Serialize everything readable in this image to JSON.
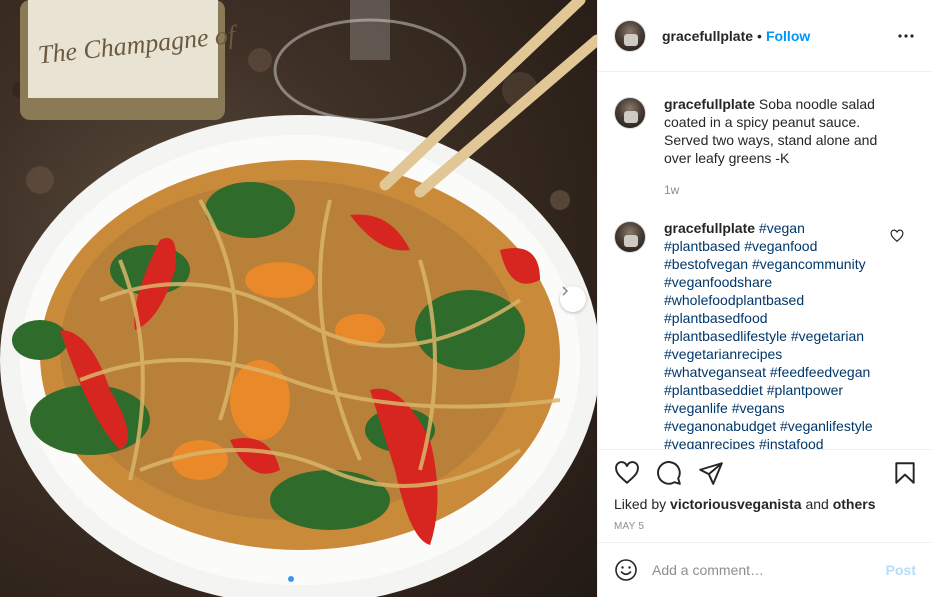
{
  "post": {
    "username": "gracefullplate",
    "separator": "•",
    "follow_label": "Follow",
    "photo_alt": "The Champagne of",
    "carousel_count": 2,
    "carousel_active": 1
  },
  "caption": {
    "username": "gracefullplate",
    "text": "Soba noodle salad coated in a spicy peanut sauce. Served two ways, stand alone and over leafy greens -K",
    "time": "1w"
  },
  "hashtag_comment": {
    "username": "gracefullplate",
    "tags": [
      "#vegan",
      "#plantbased",
      "#veganfood",
      "#bestofvegan",
      "#vegancommunity",
      "#veganfoodshare",
      "#wholefoodplantbased",
      "#plantbasedfood",
      "#plantbasedlifestyle",
      "#vegetarian",
      "#vegetarianrecipes",
      "#whatveganseat",
      "#feedfeedvegan",
      "#plantbaseddiet",
      "#plantpower",
      "#veganlife",
      "#vegans",
      "#veganonabudget",
      "#veganlifestyle",
      "#veganrecipes",
      "#instafood"
    ]
  },
  "likes": {
    "prefix": "Liked by",
    "user": "victoriousveganista",
    "and": "and",
    "others": "others"
  },
  "date": "MAY 5",
  "comment_box": {
    "placeholder": "Add a comment…",
    "post_label": "Post"
  },
  "colors": {
    "accent": "#0095f6",
    "hashtag": "#00376b",
    "muted": "#8e8e8e",
    "post_disabled": "#b2dffc"
  }
}
